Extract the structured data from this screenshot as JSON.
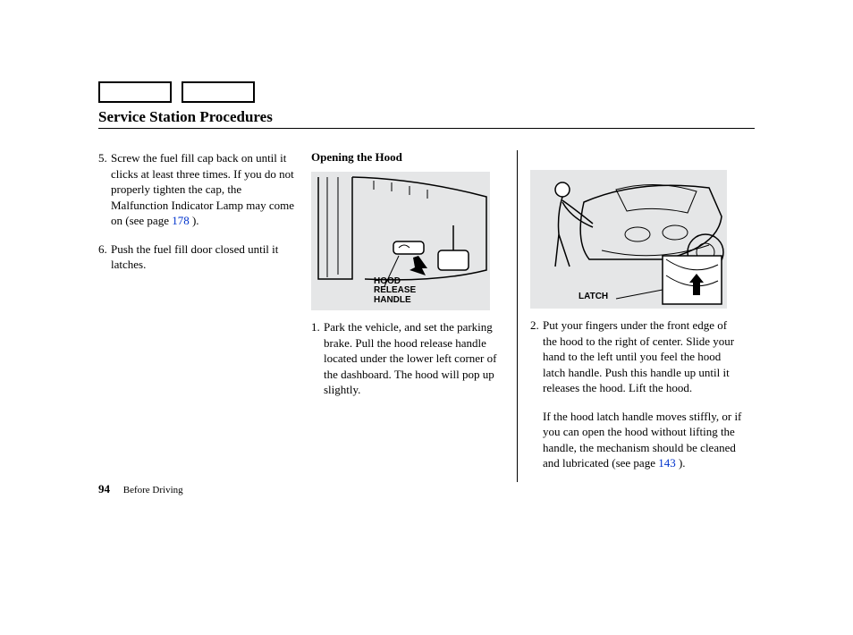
{
  "title": "Service Station Procedures",
  "col1": {
    "items": [
      {
        "num": "5.",
        "text_before": "Screw the fuel fill cap back on until it clicks at least three times. If you do not properly tighten the cap, the Malfunction Indicator Lamp may come on (see page ",
        "link": "178",
        "text_after": " )."
      },
      {
        "num": "6.",
        "text_before": "Push the fuel fill door closed until it latches.",
        "link": "",
        "text_after": ""
      }
    ]
  },
  "col2": {
    "heading": "Opening the Hood",
    "fig_label": "HOOD\nRELEASE\nHANDLE",
    "item": {
      "num": "1.",
      "text": "Park the vehicle, and set the parking brake. Pull the hood release handle located under the lower left corner of the dashboard. The hood will pop up slightly."
    }
  },
  "col3": {
    "fig_label": "LATCH",
    "item": {
      "num": "2.",
      "text": "Put your fingers under the front edge of the hood to the right of center. Slide your hand to the left until you feel the hood latch handle. Push this handle up until it releases the hood. Lift the hood."
    },
    "para2_before": "If the hood latch handle moves stiffly, or if you can open the hood without lifting the handle, the mechanism should be cleaned and lubricated (see page ",
    "para2_link": "143",
    "para2_after": " )."
  },
  "footer": {
    "page": "94",
    "section": "Before Driving"
  }
}
